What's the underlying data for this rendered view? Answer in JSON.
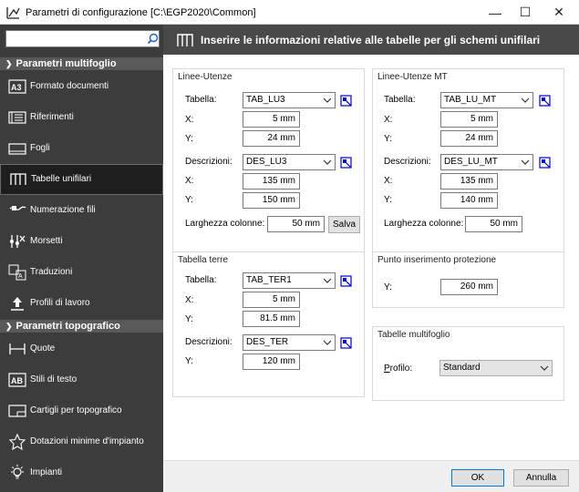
{
  "window": {
    "title": "Parametri di configurazione [C:\\EGP2020\\Common]",
    "minimize": "—",
    "maximize": "☐",
    "close": "✕"
  },
  "sidebar": {
    "search_value": "",
    "groups": [
      {
        "label": "Parametri multifoglio",
        "items": [
          {
            "label": "Formato documenti",
            "icon": "a3-format-icon"
          },
          {
            "label": "Riferimenti",
            "icon": "references-icon"
          },
          {
            "label": "Fogli",
            "icon": "sheets-icon"
          },
          {
            "label": "Tabelle unifilari",
            "icon": "single-line-tables-icon",
            "active": true
          },
          {
            "label": "Numerazione fili",
            "icon": "wire-numbering-icon"
          },
          {
            "label": "Morsetti",
            "icon": "terminals-icon"
          },
          {
            "label": "Traduzioni",
            "icon": "translations-icon"
          },
          {
            "label": "Profili di lavoro",
            "icon": "work-profiles-icon"
          }
        ]
      },
      {
        "label": "Parametri topografico",
        "items": [
          {
            "label": "Quote",
            "icon": "dimensions-icon"
          },
          {
            "label": "Stili di testo",
            "icon": "text-styles-icon"
          },
          {
            "label": "Cartigli per topografico",
            "icon": "title-blocks-icon"
          },
          {
            "label": "Dotazioni minime d'impianto",
            "icon": "minimum-equipment-icon"
          },
          {
            "label": "Impianti",
            "icon": "plants-icon"
          }
        ]
      }
    ]
  },
  "main": {
    "header": "Inserire le informazioni relative alle tabelle per gli schemi unifilari",
    "linee_utenze": {
      "title": "Linee-Utenze",
      "tabella_label": "Tabella:",
      "tabella_value": "TAB_LU3",
      "x_label": "X:",
      "x_value": "5 mm",
      "y_label": "Y:",
      "y_value": "24 mm",
      "descrizioni_label": "Descrizioni:",
      "descrizioni_value": "DES_LU3",
      "dx_label": "X:",
      "dx_value": "135 mm",
      "dy_label": "Y:",
      "dy_value": "150 mm",
      "larghezza_pre": "Lar",
      "larghezza_acc": "g",
      "larghezza_post": "hezza colonne:",
      "larghezza_value": "50 mm",
      "salva": "Salva"
    },
    "linee_utenze_mt": {
      "title": "Linee-Utenze MT",
      "tabella_label": "Tabella:",
      "tabella_value": "TAB_LU_MT",
      "x_label": "X:",
      "x_value": "5 mm",
      "y_label": "Y:",
      "y_value": "24 mm",
      "descrizioni_label": "Descrizioni:",
      "descrizioni_value": "DES_LU_MT",
      "dx_label": "X:",
      "dx_value": "135 mm",
      "dy_label": "Y:",
      "dy_value": "140 mm",
      "larghezza_pre": "Lar",
      "larghezza_acc": "g",
      "larghezza_post": "hezza colonne:",
      "larghezza_value": "50 mm"
    },
    "tabella_terre": {
      "title": "Tabella terre",
      "tabella_label": "Tabella:",
      "tabella_value": "TAB_TER1",
      "x_label": "X:",
      "x_value": "5 mm",
      "y_label": "Y:",
      "y_value": "81.5 mm",
      "descrizioni_label": "Descrizioni:",
      "descrizioni_value": "DES_TER",
      "dy_label": "Y:",
      "dy_value": "120 mm"
    },
    "punto_inserimento": {
      "title": "Punto inserimento protezione",
      "y_label": "Y:",
      "y_value": "260 mm"
    },
    "tabelle_multifoglio": {
      "title": "Tabelle multifoglio",
      "profilo_acc": "P",
      "profilo_post": "rofilo:",
      "profilo_value": "Standard"
    }
  },
  "footer": {
    "ok": "OK",
    "annulla": "Annulla"
  },
  "colors": {
    "sidebar_bg": "#3c3c3c",
    "header_bg": "#494949",
    "accent_blue": "#0000cc",
    "focus_blue": "#0078d7"
  }
}
